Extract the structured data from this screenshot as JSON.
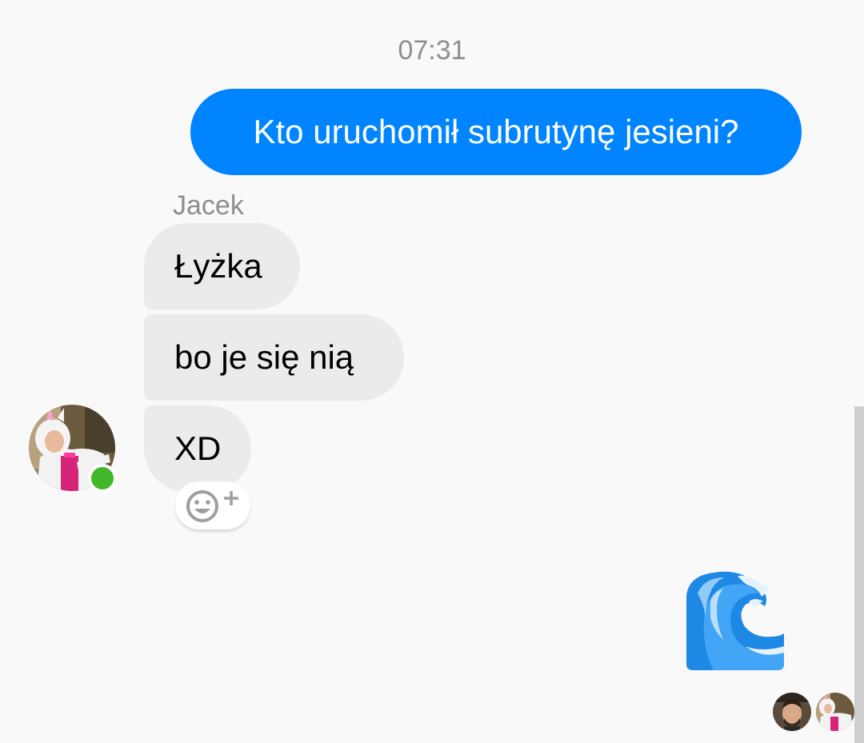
{
  "conversation": {
    "timestamp": "07:31",
    "sender_name": "Jacek",
    "messages": [
      {
        "direction": "outgoing",
        "text": "Kto uruchomił subrutynę jesieni?"
      },
      {
        "direction": "incoming",
        "text": "Łyżka"
      },
      {
        "direction": "incoming",
        "text": "bo je się nią"
      },
      {
        "direction": "incoming",
        "text": "XD"
      },
      {
        "direction": "outgoing",
        "emoji": "water-wave-emoji"
      }
    ],
    "sender_online": true
  },
  "icons": {
    "reaction": "add-reaction-icon",
    "wave": "water-wave-icon"
  },
  "colors": {
    "outgoing_bubble": "#0084ff",
    "incoming_bubble": "#ebebeb",
    "online_indicator": "#42b72a",
    "background": "#f9f9f9",
    "wave_dark": "#1e88e5",
    "wave_light": "#90caf9"
  }
}
